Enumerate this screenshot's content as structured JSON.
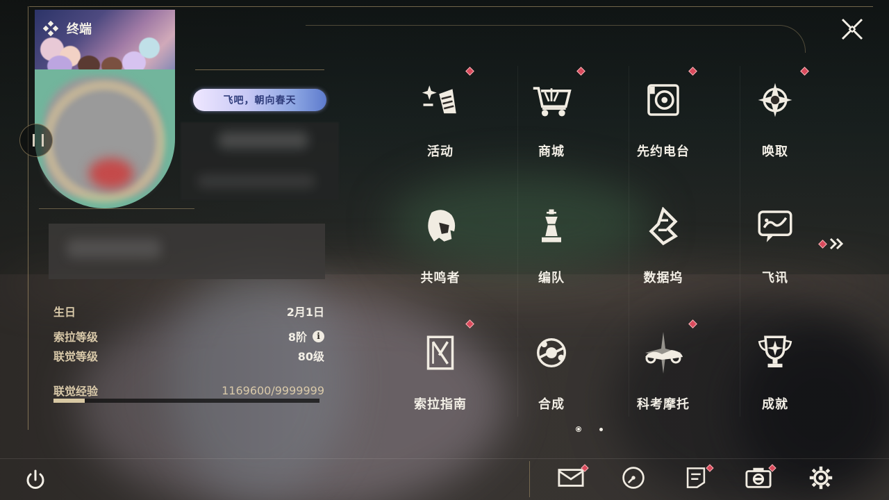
{
  "window": {
    "title": "终端"
  },
  "profile": {
    "signature": "飞吧，朝向春天"
  },
  "stats": [
    {
      "label": "生日",
      "value": "2月1日",
      "info": false
    },
    {
      "label": "索拉等级",
      "value": "8阶",
      "info": true
    },
    {
      "label": "联觉等级",
      "value": "80级",
      "info": false
    },
    {
      "label": "联觉经验",
      "value": "1169600/9999999",
      "info": false
    }
  ],
  "experience": {
    "current": 1169600,
    "max": 9999999,
    "fraction": 0.117
  },
  "menu": [
    {
      "label": "活动",
      "icon": "sparkle-flag-icon",
      "badge": true
    },
    {
      "label": "商城",
      "icon": "shopping-cart-icon",
      "badge": true
    },
    {
      "label": "先约电台",
      "icon": "radio-icon",
      "badge": true
    },
    {
      "label": "唤取",
      "icon": "compass-star-icon",
      "badge": true
    },
    {
      "label": "共鸣者",
      "icon": "character-portrait-icon",
      "badge": false
    },
    {
      "label": "编队",
      "icon": "chess-piece-icon",
      "badge": false
    },
    {
      "label": "数据坞",
      "icon": "data-dock-icon",
      "badge": false
    },
    {
      "label": "飞讯",
      "icon": "chat-message-icon",
      "badge": false
    },
    {
      "label": "索拉指南",
      "icon": "guide-book-icon",
      "badge": true
    },
    {
      "label": "合成",
      "icon": "synthesis-icon",
      "badge": false
    },
    {
      "label": "科考摩托",
      "icon": "motorcycle-icon",
      "badge": true
    },
    {
      "label": "成就",
      "icon": "trophy-icon",
      "badge": false
    }
  ],
  "pagination": {
    "current": 1,
    "total": 2,
    "next_badge": true
  },
  "bottom_bar": [
    {
      "name": "mail",
      "icon": "mail-icon",
      "badge": true
    },
    {
      "name": "clock",
      "icon": "clock-icon",
      "badge": false
    },
    {
      "name": "notice",
      "icon": "notice-icon",
      "badge": true
    },
    {
      "name": "camera",
      "icon": "camera-icon",
      "badge": true
    },
    {
      "name": "settings",
      "icon": "gear-icon",
      "badge": false
    }
  ],
  "colors": {
    "accent_gold": "#c4aa78",
    "badge_red": "#d94a5c",
    "text_light": "#f3efe6",
    "label_beige": "#d9c9a9"
  }
}
